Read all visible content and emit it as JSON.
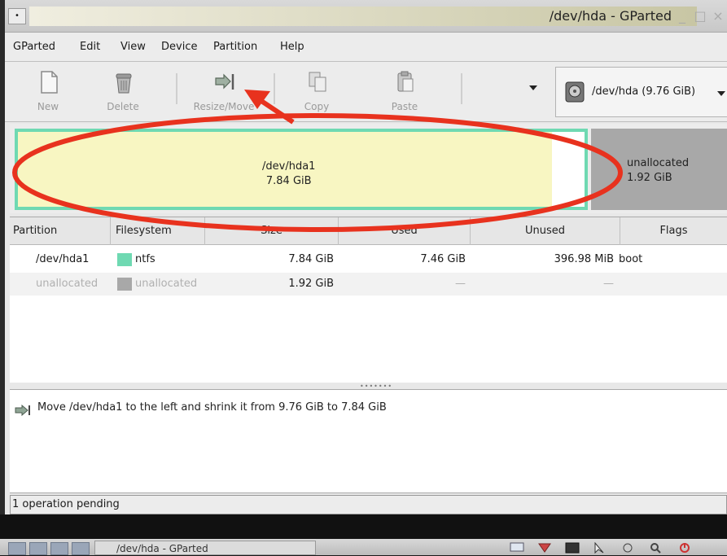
{
  "window": {
    "title": "/dev/hda - GParted"
  },
  "menu": [
    {
      "label": "GParted"
    },
    {
      "label": "Edit"
    },
    {
      "label": "View"
    },
    {
      "label": "Device"
    },
    {
      "label": "Partition"
    },
    {
      "label": "Help"
    }
  ],
  "toolbar": {
    "new_label": "New",
    "delete_label": "Delete",
    "resize_label": "Resize/Move",
    "copy_label": "Copy",
    "paste_label": "Paste",
    "device_label": "/dev/hda  (9.76 GiB)"
  },
  "diskmap": {
    "hda1_name": "/dev/hda1",
    "hda1_size": "7.84 GiB",
    "unalloc_name": "unallocated",
    "unalloc_size": "1.92 GiB"
  },
  "table": {
    "headers": [
      "Partition",
      "Filesystem",
      "Size",
      "Used",
      "Unused",
      "Flags"
    ],
    "rows": [
      {
        "partition": "/dev/hda1",
        "filesystem": "ntfs",
        "size": "7.84 GiB",
        "used": "7.46 GiB",
        "unused": "396.98 MiB",
        "flags": "boot"
      },
      {
        "partition": "unallocated",
        "filesystem": "unallocated",
        "size": "1.92 GiB",
        "used": "—",
        "unused": "—",
        "flags": ""
      }
    ]
  },
  "operations": [
    {
      "text": "Move /dev/hda1 to the left and shrink it from 9.76 GiB to 7.84 GiB"
    }
  ],
  "status": {
    "text": "1 operation pending"
  },
  "taskbar": {
    "window_label": "/dev/hda - GParted"
  },
  "colors": {
    "ntfs": "#6fd9b2",
    "unallocated": "#a8a8a8",
    "annotation": "#e8321e"
  }
}
